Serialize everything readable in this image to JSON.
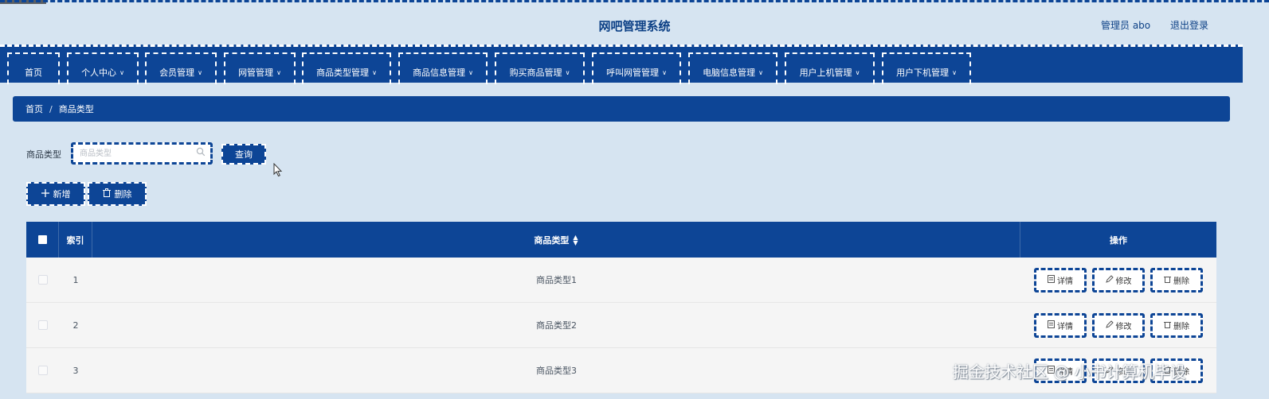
{
  "app": {
    "title": "网吧管理系统",
    "user_label": "管理员 abo",
    "logout_label": "退出登录"
  },
  "nav": {
    "items": [
      {
        "label": "首页",
        "dropdown": false
      },
      {
        "label": "个人中心",
        "dropdown": true
      },
      {
        "label": "会员管理",
        "dropdown": true
      },
      {
        "label": "网管管理",
        "dropdown": true
      },
      {
        "label": "商品类型管理",
        "dropdown": true
      },
      {
        "label": "商品信息管理",
        "dropdown": true
      },
      {
        "label": "购买商品管理",
        "dropdown": true
      },
      {
        "label": "呼叫网管管理",
        "dropdown": true
      },
      {
        "label": "电脑信息管理",
        "dropdown": true
      },
      {
        "label": "用户上机管理",
        "dropdown": true
      },
      {
        "label": "用户下机管理",
        "dropdown": true
      }
    ]
  },
  "breadcrumb": {
    "home": "首页",
    "separator": "/",
    "current": "商品类型"
  },
  "search": {
    "label": "商品类型",
    "placeholder": "商品类型",
    "value": "",
    "button_label": "查询"
  },
  "actions": {
    "add_label": "新增",
    "delete_label": "删除"
  },
  "table": {
    "headers": {
      "index": "索引",
      "type": "商品类型",
      "operations": "操作"
    },
    "row_buttons": {
      "detail": "详情",
      "edit": "修改",
      "delete": "删除"
    },
    "rows": [
      {
        "index": "1",
        "type": "商品类型1"
      },
      {
        "index": "2",
        "type": "商品类型2"
      },
      {
        "index": "3",
        "type": "商品类型3"
      }
    ]
  },
  "watermark": "掘金技术社区 @ 小书计算机毕设",
  "colors": {
    "primary": "#0d4596",
    "background": "#d6e4f1",
    "row_background": "#f5f5f5"
  }
}
